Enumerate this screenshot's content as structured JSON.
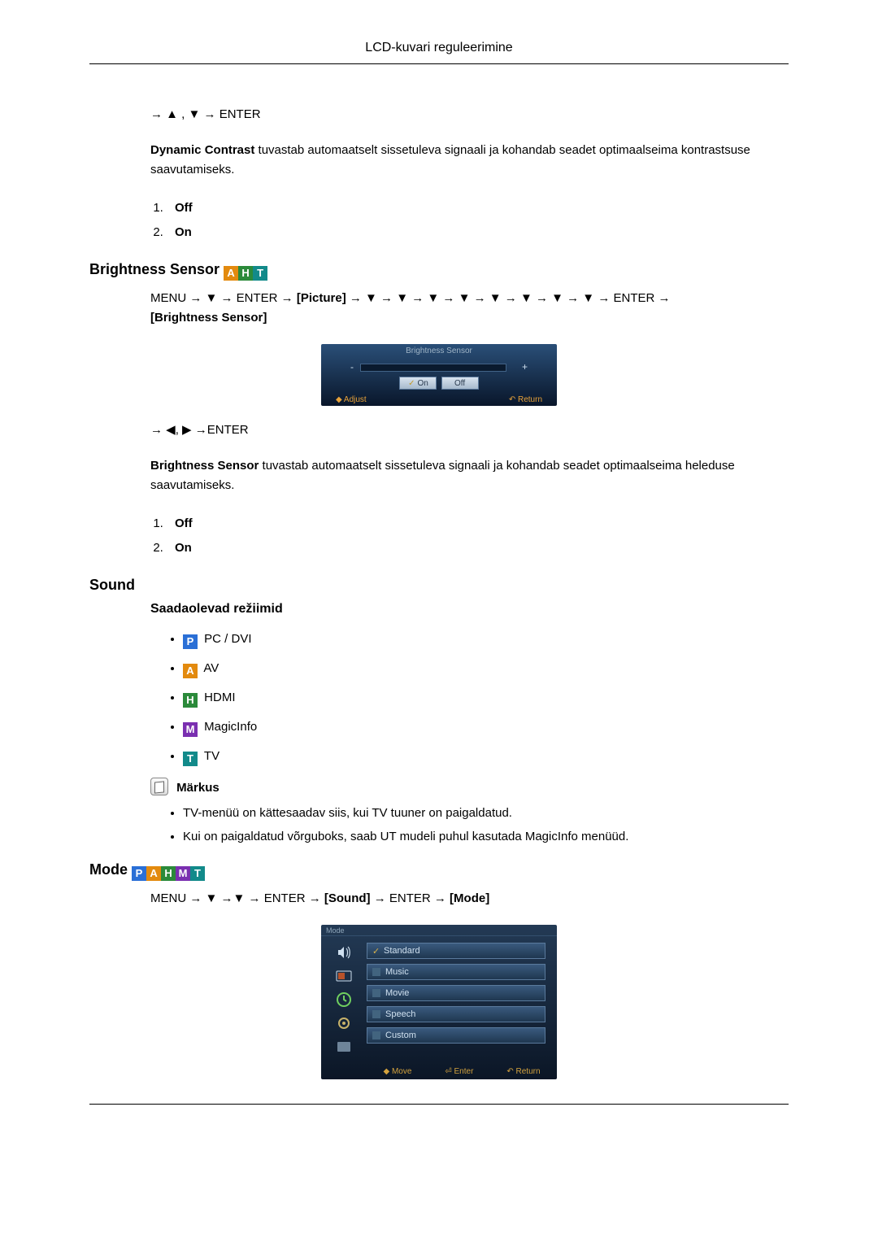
{
  "header": {
    "title": "LCD-kuvari reguleerimine"
  },
  "dc": {
    "nav1": "→ ▲ , ▼ → ENTER",
    "desc_b": "Dynamic Contrast",
    "desc": " tuvastab automaatselt sissetuleva signaali ja kohandab seadet optimaalseima kontrastsuse saavutamiseks.",
    "opt1": "Off",
    "opt2": "On"
  },
  "bs": {
    "heading": "Brightness Sensor",
    "nav": "MENU → ▼ → ENTER → ",
    "picture": "[Picture]",
    "nav2": " → ▼ → ▼ → ▼ → ▼ → ▼ → ▼ → ▼ → ▼ → ENTER → ",
    "target": "[Brightness Sensor]",
    "osd": {
      "title": "Brightness Sensor",
      "on": "On",
      "off": "Off",
      "adjust": "Adjust",
      "return": "Return"
    },
    "nav3": "→ ◀, ▶ →ENTER",
    "desc_b": "Brightness Sensor",
    "desc": "  tuvastab automaatselt sissetuleva signaali ja kohandab seadet optimaalseima heleduse saavutamiseks.",
    "opt1": "Off",
    "opt2": "On"
  },
  "sound": {
    "heading": "Sound",
    "sub": "Saadaolevad režiimid",
    "modes": {
      "pc": "PC / DVI",
      "av": "AV",
      "hdmi": "HDMI",
      "mi": "MagicInfo",
      "tv": "TV"
    },
    "note_label": "Märkus",
    "notes": [
      "TV-menüü on kättesaadav siis, kui TV tuuner on paigaldatud.",
      "Kui on paigaldatud võrguboks, saab UT mudeli puhul kasutada MagicInfo menüüd."
    ]
  },
  "mode": {
    "heading": "Mode",
    "nav": "MENU → ▼ →▼ → ENTER → ",
    "sound": "[Sound]",
    "nav2": " → ENTER → ",
    "target": "[Mode]",
    "osd": {
      "title": "Mode",
      "rows": [
        "Standard",
        "Music",
        "Movie",
        "Speech",
        "Custom"
      ],
      "move": "Move",
      "enter": "Enter",
      "return": "Return"
    }
  },
  "badges": {
    "P": "P",
    "A": "A",
    "H": "H",
    "M": "M",
    "T": "T"
  }
}
